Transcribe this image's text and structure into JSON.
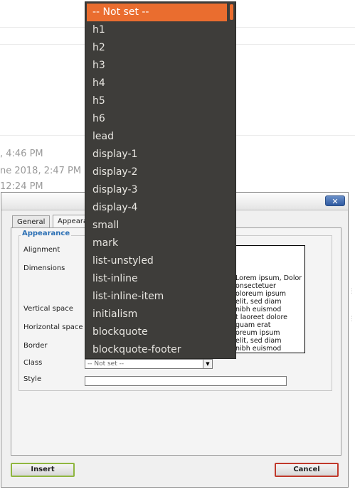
{
  "background": {
    "timestamps": [
      ", 4:46 PM",
      "ne 2018, 2:47 PM",
      "12:24 PM"
    ]
  },
  "dialog": {
    "close_label": "✕",
    "tabs": [
      {
        "label": "General",
        "active": false
      },
      {
        "label": "Appeara",
        "active": true
      }
    ],
    "legend": "Appearance",
    "labels": {
      "alignment": "Alignment",
      "dimensions": "Dimensions",
      "vertical_space": "Vertical space",
      "horizontal_space": "Horizontal space",
      "border": "Border",
      "class": "Class",
      "style": "Style"
    },
    "preview_lines": [
      "Lorem ipsum, Dolor",
      "onsectetuer",
      "oloreum ipsum",
      "elit, sed diam",
      "nibh euismod",
      "t laoreet dolore",
      "guam erat",
      "oreum ipsum",
      "elit, sed diam",
      "nibh euismod"
    ],
    "class_select_value": "-- Not set --",
    "style_value": "",
    "insert_label": "Insert",
    "cancel_label": "Cancel"
  },
  "dropdown": {
    "selected": "-- Not set --",
    "options": [
      "h1",
      "h2",
      "h3",
      "h4",
      "h5",
      "h6",
      "lead",
      "display-1",
      "display-2",
      "display-3",
      "display-4",
      "small",
      "mark",
      "list-unstyled",
      "list-inline",
      "list-inline-item",
      "initialism",
      "blockquote",
      "blockquote-footer"
    ]
  },
  "colors": {
    "dropdown_bg": "#3e3d3a",
    "dropdown_highlight": "#ea6d2f",
    "legend_text": "#2b6fb4",
    "insert_border": "#8fb640",
    "cancel_border": "#c0392b"
  }
}
